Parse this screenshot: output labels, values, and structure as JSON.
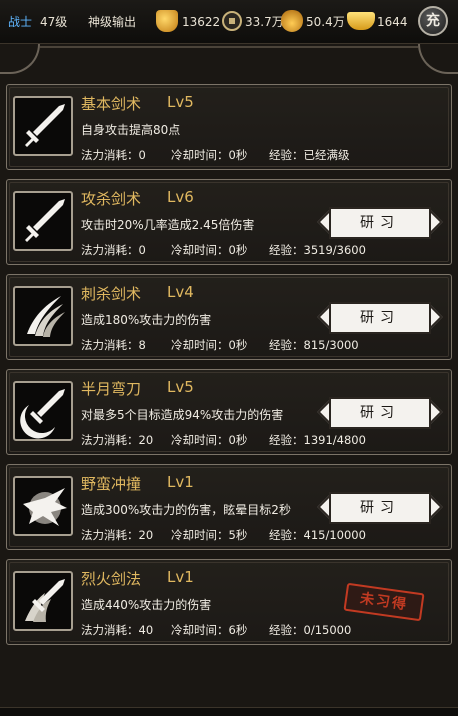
{
  "topbar": {
    "class_label": "战士",
    "level": "47级",
    "rank": "神级输出",
    "power_value": "13622",
    "coin_value": "33.7万",
    "bag_value": "50.4万",
    "ingot_value": "1644",
    "charge_label": "充"
  },
  "skills": [
    {
      "name": "基本剑术",
      "level": "Lv5",
      "desc": "自身攻击提高80点",
      "mp": "法力消耗：0",
      "cd": "冷却时间：0秒",
      "xp": "经验：已经满级",
      "icon": "sword-icon",
      "action": "none"
    },
    {
      "name": "攻杀剑术",
      "level": "Lv6",
      "desc": "攻击时20%几率造成2.45倍伤害",
      "mp": "法力消耗：0",
      "cd": "冷却时间：0秒",
      "xp": "经验：3519/3600",
      "icon": "sword-icon",
      "action": "研习"
    },
    {
      "name": "刺杀剑术",
      "level": "Lv4",
      "desc": "造成180%攻击力的伤害",
      "mp": "法力消耗：8",
      "cd": "冷却时间：0秒",
      "xp": "经验：815/3000",
      "icon": "claw-slash-icon",
      "action": "研习"
    },
    {
      "name": "半月弯刀",
      "level": "Lv5",
      "desc": "对最多5个目标造成94%攻击力的伤害",
      "mp": "法力消耗：20",
      "cd": "冷却时间：0秒",
      "xp": "经验：1391/4800",
      "icon": "crescent-sword-icon",
      "action": "研习"
    },
    {
      "name": "野蛮冲撞",
      "level": "Lv1",
      "desc": "造成300%攻击力的伤害，眩晕目标2秒",
      "mp": "法力消耗：20",
      "cd": "冷却时间：5秒",
      "xp": "经验：415/10000",
      "icon": "charge-icon",
      "action": "研习"
    },
    {
      "name": "烈火剑法",
      "level": "Lv1",
      "desc": "造成440%攻击力的伤害",
      "mp": "法力消耗：40",
      "cd": "冷却时间：6秒",
      "xp": "经验：0/15000",
      "icon": "fire-sword-icon",
      "action": "未习得"
    }
  ]
}
